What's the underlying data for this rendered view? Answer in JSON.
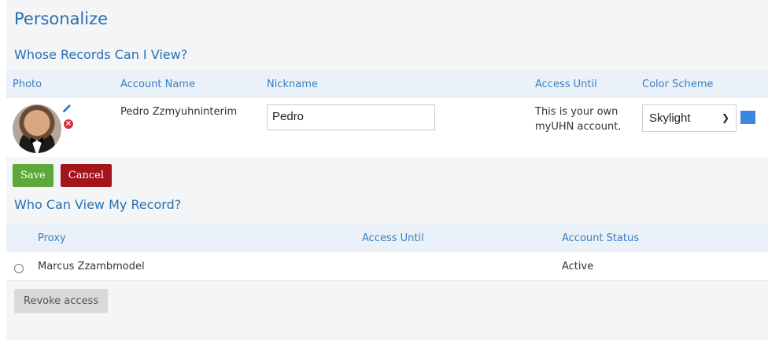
{
  "page": {
    "title": "Personalize"
  },
  "records_section": {
    "title": "Whose Records Can I View?",
    "headers": {
      "photo": "Photo",
      "account_name": "Account Name",
      "nickname": "Nickname",
      "access_until": "Access Until",
      "color_scheme": "Color Scheme"
    },
    "row": {
      "account_name": "Pedro Zzmyuhninterim",
      "nickname_value": "Pedro",
      "access_line1": "This is your own",
      "access_line2": "myUHN account.",
      "color_scheme": "Skylight",
      "swatch_color": "#3c86dd"
    }
  },
  "actions": {
    "save": "Save",
    "cancel": "Cancel"
  },
  "viewers_section": {
    "title": "Who Can View My Record?",
    "headers": {
      "proxy": "Proxy",
      "access_until": "Access Until",
      "account_status": "Account Status"
    },
    "rows": [
      {
        "proxy": "Marcus Zzambmodel",
        "access_until": "",
        "account_status": "Active"
      }
    ],
    "revoke": "Revoke access"
  },
  "colors": {
    "accent": "#2a6fb3",
    "save": "#5ca83b",
    "cancel": "#a3141b",
    "header_bg": "#eaf1f8"
  },
  "icons": [
    "edit-pencil-icon",
    "remove-photo-icon",
    "chevron-down-icon",
    "radio-icon"
  ]
}
